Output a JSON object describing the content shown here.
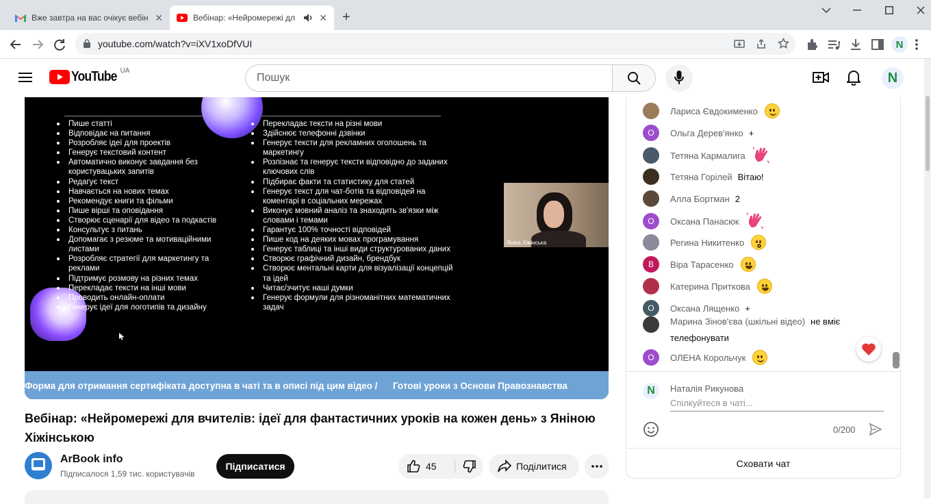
{
  "browser": {
    "tabs": [
      {
        "title": "Вже завтра на вас очікує вебін",
        "active": false,
        "icon": "gmail-icon"
      },
      {
        "title": "Вебінар: «Нейромережі дл",
        "active": true,
        "icon": "youtube-icon"
      }
    ],
    "url": "youtube.com/watch?v=iXV1xoDfVUI",
    "profile_letter": "N"
  },
  "youtube": {
    "logo_text": "YouTube",
    "region": "UA",
    "search_placeholder": "Пошук",
    "avatar_letter": "N"
  },
  "video": {
    "slide": {
      "left_items": [
        "Пише статті",
        "Відповідає на питання",
        "Розробляє ідеї для проектів",
        "Генерує текстовий контент",
        "Автоматично виконує завдання без користувацьких запитів",
        "Редагує текст",
        "Навчається на нових темах",
        "Рекомендує книги та фільми",
        "Пише вірші та оповідання",
        "Створює сценарії для відео та подкастів",
        "Консультує з питань",
        "Допомагає з резюме та мотиваційними листами",
        "Розробляє стратегії для маркетингу та реклами",
        "Підтримує розмову на різних темах",
        "Перекладає тексти на інші мови",
        "Проводить онлайн-оплати",
        "Генерує ідеї для логотипів та дизайну"
      ],
      "right_items": [
        "Перекладає тексти на різні мови",
        "Здійснює телефонні дзвінки",
        "Генерує тексти для рекламних оголошень та маркетингу",
        "Розпізнає та генерує тексти відповідно до заданих ключових слів",
        "Підбирає факти та статистику для статей",
        "Генерує текст для чат-ботів та відповідей на коментарі в соціальних мережах",
        "Виконує мовний аналіз та знаходить зв'язки між словами і темами",
        "Гарантує 100% точності відповідей",
        "Пише код на деяких мовах програмування",
        "Генерує таблиці та інші види структурованих даних",
        "Створює графічний дизайн, брендбук",
        "Створює ментальні карти для візуалізації концепцій та ідей",
        "Читає/зчитує наші думки",
        "Генерує формули для різноманітних математичних задач"
      ]
    },
    "cam_label": "Яніна Хіжінська",
    "ticker": "Форма для отримання сертифіката доступна в чаті та в описі під цим відео /      Готові уроки з Основи Правознавства",
    "title": "Вебінар: «Нейромережі для вчителів: ідеї для фантастичних уроків на кожен день» з Яніною Хіжінською",
    "channel_name": "ArBook info",
    "channel_subs": "Підписалося 1,59 тис. користувачів",
    "subscribe_label": "Підписатися",
    "likes": "45",
    "share_label": "Поділитися"
  },
  "chat": {
    "messages": [
      {
        "author": "Лариса Євдокименко",
        "text": "",
        "emoji": "smile",
        "avatar": "photo",
        "color": "#9a7b5a"
      },
      {
        "author": "Ольга Дерев'янко",
        "text": "+",
        "emoji": "",
        "avatar": "letter",
        "letter": "О",
        "color": "#9c4dcc"
      },
      {
        "author": "Тетяна Кармалига",
        "text": "",
        "emoji": "wave",
        "avatar": "photo",
        "color": "#4a5a6a"
      },
      {
        "author": "Тетяна Горілей",
        "text": "Вітаю!",
        "emoji": "",
        "avatar": "photo",
        "color": "#3d2e22"
      },
      {
        "author": "Алла Бортман",
        "text": "2",
        "emoji": "",
        "avatar": "photo",
        "color": "#5b4a3a"
      },
      {
        "author": "Оксана Панасюк",
        "text": "",
        "emoji": "wave",
        "avatar": "letter",
        "letter": "О",
        "color": "#9c4dcc"
      },
      {
        "author": "Регина Никитенко",
        "text": "",
        "emoji": "wow",
        "avatar": "photo",
        "color": "#8a8a9a"
      },
      {
        "author": "Віра Тарасенко",
        "text": "",
        "emoji": "grin",
        "avatar": "letter",
        "letter": "В",
        "color": "#c2185b"
      },
      {
        "author": "Катерина Приткова",
        "text": "",
        "emoji": "grin",
        "avatar": "photo",
        "color": "#b0304a"
      },
      {
        "author": "Оксана Лященко",
        "text": "+",
        "emoji": "",
        "avatar": "letter",
        "letter": "О",
        "color": "#455a64"
      },
      {
        "author": "Марина Зінов'єва (шкільні відео)",
        "text": "не вміє",
        "text2": "телефонувати",
        "emoji": "",
        "avatar": "photo",
        "color": "#3a3a3a"
      },
      {
        "author": "ОЛЕНА Корольчук",
        "text": "",
        "emoji": "smile",
        "avatar": "letter",
        "letter": "О",
        "color": "#9c4dcc"
      }
    ],
    "current_user": "Наталія Рикунова",
    "current_user_letter": "N",
    "input_placeholder": "Спілкуйтеся в чаті...",
    "char_count": "0/200",
    "hide_label": "Сховати чат"
  },
  "colors": {
    "yt_red": "#ff0000",
    "ticker_blue": "#6fa3d6",
    "profile_green": "#1e8e3e"
  }
}
